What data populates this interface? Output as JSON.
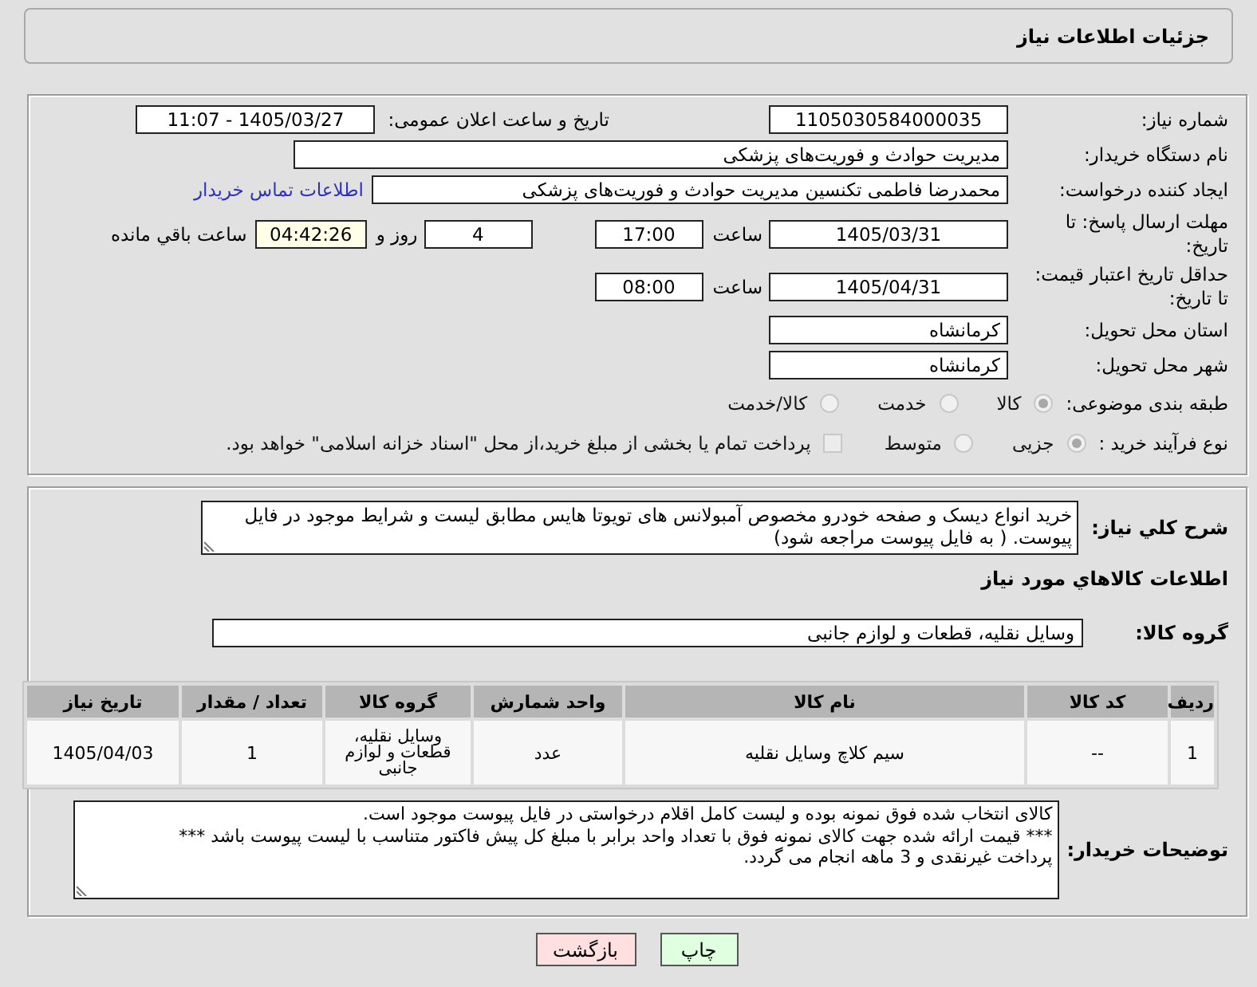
{
  "header": {
    "title": "جزئیات اطلاعات نیاز"
  },
  "details": {
    "need_number": {
      "label": "شماره نیاز:",
      "value": "1105030584000035"
    },
    "announcement": {
      "label": "تاریخ و ساعت اعلان عمومی:",
      "value": "1405/03/27 - 11:07"
    },
    "buyer_organization": {
      "label": "نام دستگاه خریدار:",
      "value": "مدیریت حوادث و فوریت‌های پزشکی"
    },
    "requester": {
      "label": "ایجاد کننده درخواست:",
      "value": "محمدرضا فاطمی تکنسین مدیریت حوادث و فوریت‌های پزشکی",
      "contact_link": "اطلاعات تماس خریدار"
    },
    "response_deadline": {
      "label": "مهلت ارسال پاسخ: تا تاریخ:",
      "date": "1405/03/31",
      "time_label": "ساعت",
      "time": "17:00",
      "days": "4",
      "days_label": "روز و",
      "remaining": "04:42:26",
      "remaining_label": "ساعت باقي مانده"
    },
    "price_validity": {
      "label": "حداقل تاریخ اعتبار قیمت: تا تاریخ:",
      "date": "1405/04/31",
      "time_label": "ساعت",
      "time": "08:00"
    },
    "delivery_province": {
      "label": "استان محل تحویل:",
      "value": "کرمانشاه"
    },
    "delivery_city": {
      "label": "شهر محل تحویل:",
      "value": "کرمانشاه"
    },
    "subject_category": {
      "label": "طبقه بندی موضوعی:",
      "options": [
        {
          "label": "کالا",
          "selected": true,
          "disabled": true
        },
        {
          "label": "خدمت",
          "selected": false,
          "disabled": true
        },
        {
          "label": "کالا/خدمت",
          "selected": false,
          "disabled": true
        }
      ]
    },
    "purchase_process": {
      "label": "نوع فرآیند خرید :",
      "options": [
        {
          "label": "جزیی",
          "selected": true,
          "disabled": true
        },
        {
          "label": "متوسط",
          "selected": false,
          "disabled": true
        }
      ],
      "treasury_payment": {
        "label": "پرداخت تمام یا بخشی از مبلغ خرید،از محل \"اسناد خزانه اسلامی\" خواهد بود.",
        "checked": false,
        "disabled": true
      }
    }
  },
  "requirements": {
    "description": {
      "label": "شرح کلي نياز:",
      "value": "خرید انواع دیسک و صفحه خودرو مخصوص آمبولانس های تویوتا هایس مطابق لیست و شرایط موجود در فایل پیوست. ( به فایل پیوست مراجعه شود)"
    },
    "goods_heading": "اطلاعات کالاهاي مورد نياز",
    "goods_group": {
      "label": "گروه کالا:",
      "value": "وسایل نقلیه، قطعات و لوازم جانبی"
    },
    "items_table": {
      "columns": [
        "ردیف",
        "کد کالا",
        "نام کالا",
        "واحد شمارش",
        "گروه کالا",
        "تعداد / مقدار",
        "تاریخ نیاز"
      ],
      "rows": [
        [
          "1",
          "--",
          "سیم کلاچ وسایل نقلیه",
          "عدد",
          "وسایل نقلیه، قطعات و لوازم جانبی",
          "1",
          "1405/04/03"
        ]
      ]
    },
    "buyer_notes": {
      "label": "توضیحات خریدار:",
      "value": "کالای انتخاب شده فوق نمونه بوده و لیست کامل اقلام درخواستی در فایل پیوست موجود است.\n*** قیمت ارائه شده جهت کالای نمونه فوق با تعداد واحد برابر با مبلغ کل پیش فاکتور متناسب با لیست پیوست باشد ***\nپرداخت غیرنقدی و 3 ماهه انجام می گردد."
    }
  },
  "buttons": [
    {
      "label": "چاپ",
      "kind": "print"
    },
    {
      "label": "بازگشت",
      "kind": "back"
    }
  ]
}
